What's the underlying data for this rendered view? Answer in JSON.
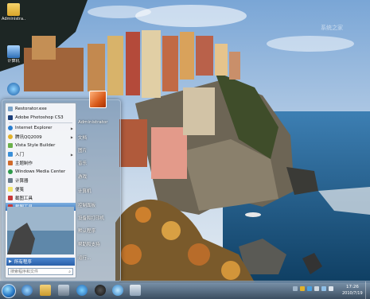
{
  "desktop": {
    "icons": [
      {
        "label": "Administra...",
        "icon": "folder-icon"
      },
      {
        "label": "计算机",
        "icon": "computer-icon"
      }
    ],
    "watermark": "系统之家"
  },
  "start_menu": {
    "programs": [
      {
        "label": "Restorator.exe",
        "icon": "restorator-icon",
        "arrow": ""
      },
      {
        "label": "Adobe Photoshop CS3",
        "icon": "photoshop-icon",
        "arrow": ""
      },
      {
        "label": "Internet Explorer",
        "icon": "ie-icon",
        "arrow": "▶"
      },
      {
        "label": "腾讯QQ2009",
        "icon": "qq-icon",
        "arrow": "▶"
      },
      {
        "label": "Vista Style Builder",
        "icon": "vista-builder-icon",
        "arrow": ""
      },
      {
        "label": "入门",
        "icon": "getting-started-icon",
        "arrow": "▶"
      },
      {
        "label": "主题制作",
        "icon": "theme-maker-icon",
        "arrow": ""
      },
      {
        "label": "Windows Media Center",
        "icon": "media-center-icon",
        "arrow": ""
      },
      {
        "label": "计算器",
        "icon": "calculator-icon",
        "arrow": ""
      },
      {
        "label": "便笺",
        "icon": "sticky-notes-icon",
        "arrow": ""
      },
      {
        "label": "截图工具",
        "icon": "snipping-tool-icon",
        "arrow": ""
      },
      {
        "label": "截图工具",
        "icon": "snipping-tool-icon",
        "arrow": ""
      }
    ],
    "all_programs_label": "所有程序",
    "search_placeholder": "搜索程序和文件",
    "right_links": [
      "Administrator",
      "文档",
      "图片",
      "音乐",
      "游戏",
      "计算机",
      "控制面板",
      "设备和打印机",
      "默认程序",
      "帮助和支持",
      "运行..."
    ]
  },
  "taskbar": {
    "pinned": [
      "ie-icon",
      "explorer-icon",
      "media-player-icon",
      "network-icon",
      "qq-icon",
      "sky-icon",
      "window-icon"
    ],
    "clock_time": "17:26",
    "clock_date": "2010/7/19"
  },
  "colors": {
    "sky": "#8fb3db",
    "sea": "#1f5f8e",
    "highlight": "#3b78c0"
  }
}
